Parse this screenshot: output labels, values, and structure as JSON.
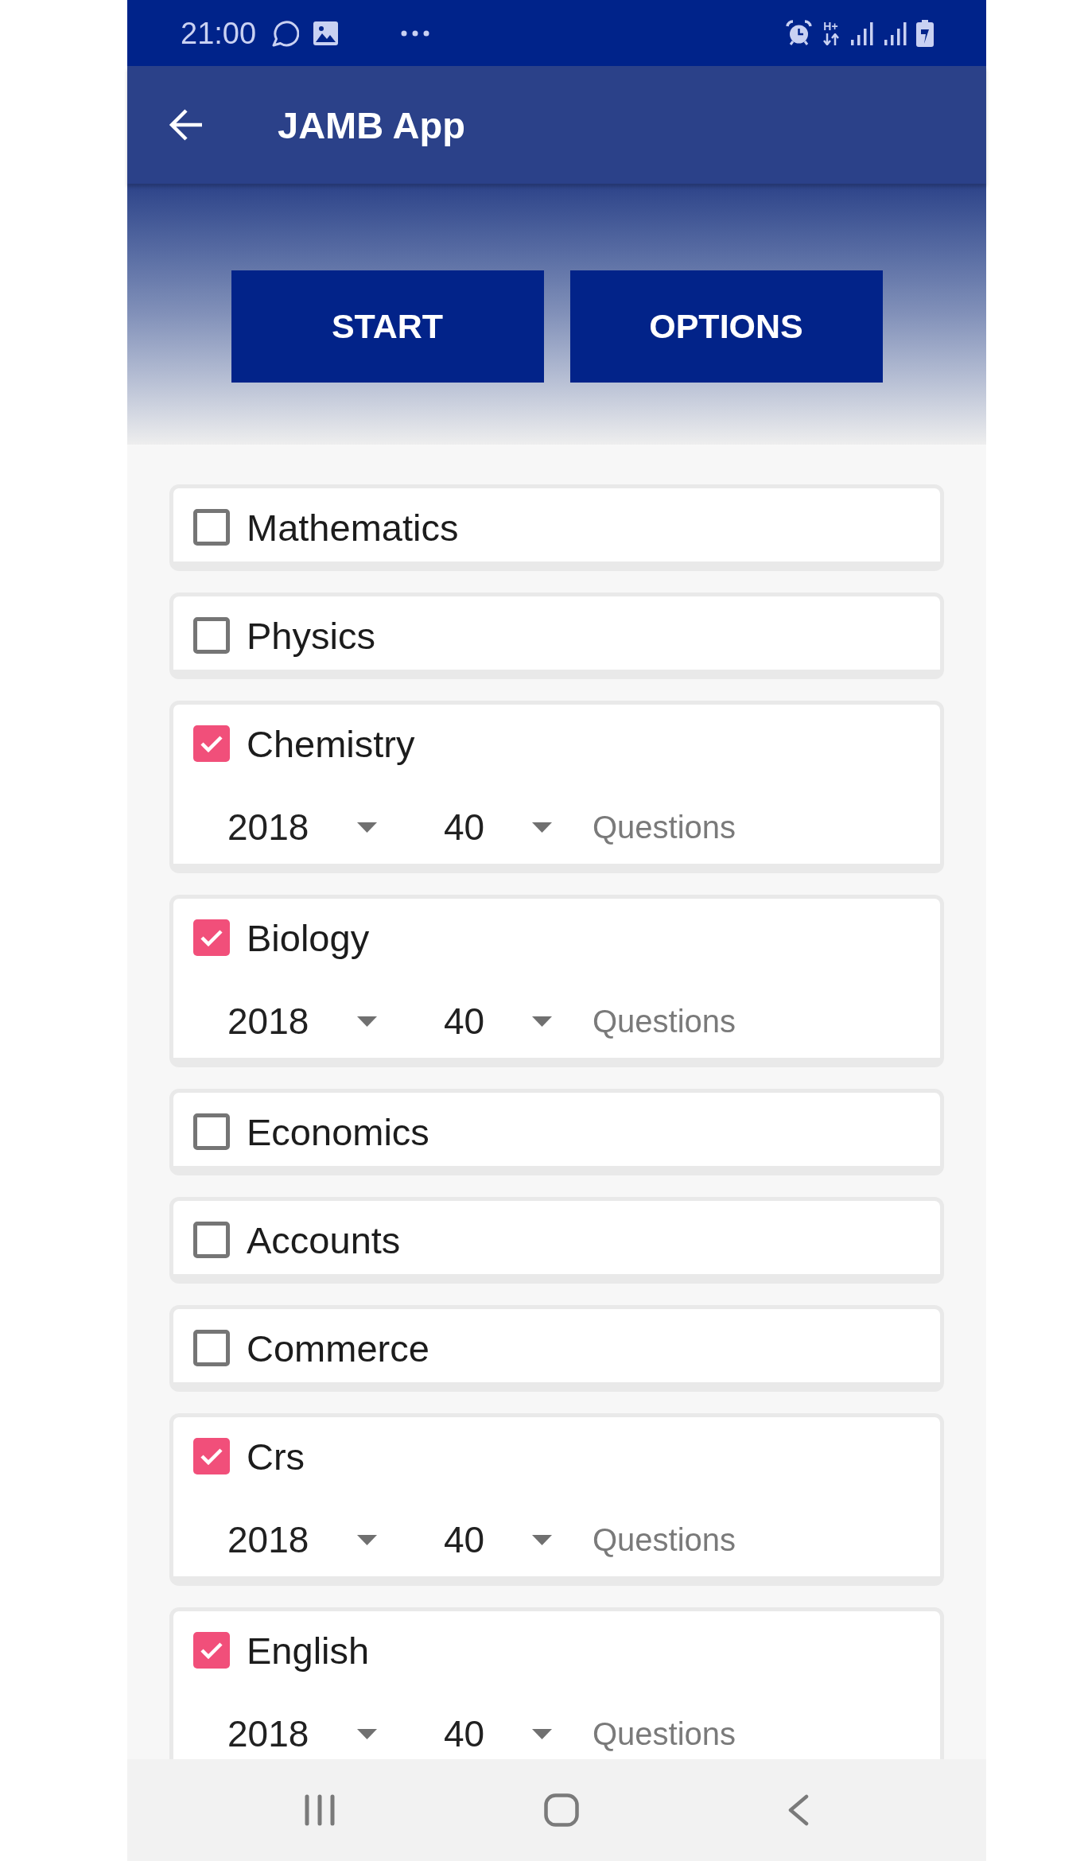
{
  "status_bar": {
    "time": "21:00",
    "network_type": "H+"
  },
  "app_bar": {
    "title": "JAMB App"
  },
  "actions": [
    {
      "label": "START"
    },
    {
      "label": "OPTIONS"
    }
  ],
  "subjects": [
    {
      "name": "Mathematics",
      "checked": false
    },
    {
      "name": "Physics",
      "checked": false
    },
    {
      "name": "Chemistry",
      "checked": true,
      "year": "2018",
      "count": "40",
      "unit": "Questions"
    },
    {
      "name": "Biology",
      "checked": true,
      "year": "2018",
      "count": "40",
      "unit": "Questions"
    },
    {
      "name": "Economics",
      "checked": false
    },
    {
      "name": "Accounts",
      "checked": false
    },
    {
      "name": "Commerce",
      "checked": false
    },
    {
      "name": "Crs",
      "checked": true,
      "year": "2018",
      "count": "40",
      "unit": "Questions"
    },
    {
      "name": "English",
      "checked": true,
      "year": "2018",
      "count": "40",
      "unit": "Questions"
    }
  ]
}
